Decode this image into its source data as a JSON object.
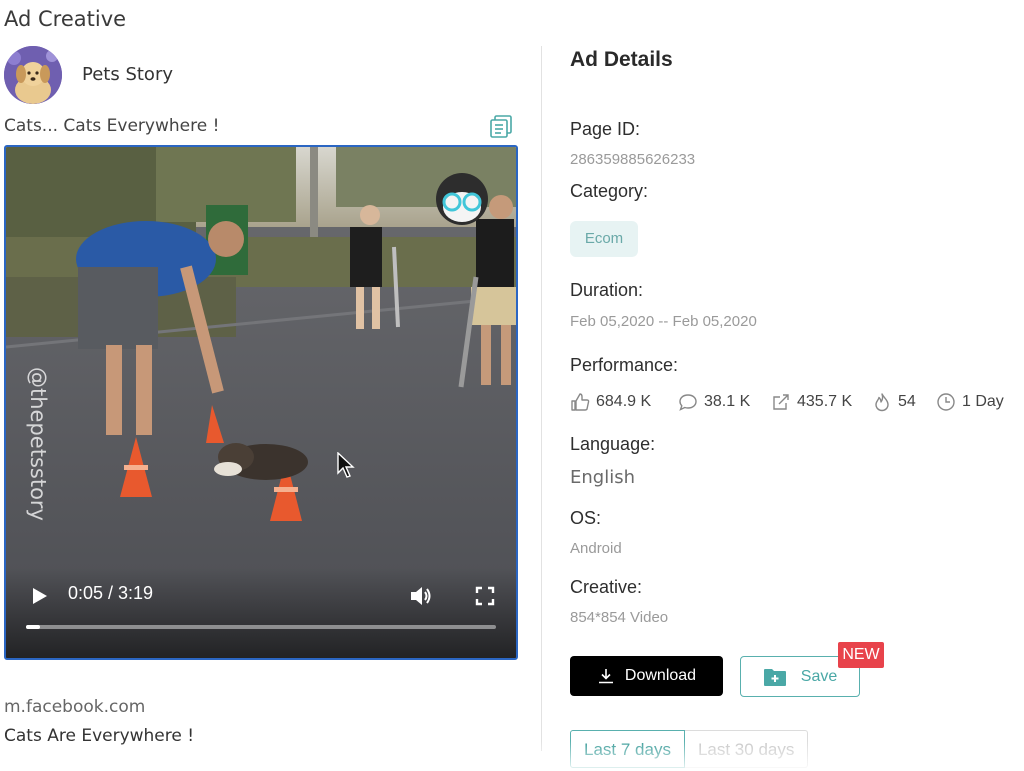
{
  "creative": {
    "section_title": "Ad Creative",
    "page_name": "Pets Story",
    "ad_text": "Cats... Cats Everywhere !",
    "watermark": "@thepetsstory",
    "video": {
      "time": "0:05 / 3:19",
      "progress": 0.03
    },
    "link_domain": "m.facebook.com",
    "link_title": "Cats Are Everywhere !"
  },
  "details": {
    "title": "Ad Details",
    "page_id_label": "Page ID:",
    "page_id": "286359885626233",
    "category_label": "Category:",
    "category": "Ecom",
    "duration_label": "Duration:",
    "duration": "Feb 05,2020 -- Feb 05,2020",
    "performance_label": "Performance:",
    "stats": {
      "likes": "684.9 K",
      "comments": "38.1 K",
      "shares": "435.7 K",
      "popularity": "54",
      "days": "1 Day"
    },
    "language_label": "Language:",
    "language": "English",
    "os_label": "OS:",
    "os": "Android",
    "creative_label": "Creative:",
    "creative": "854*854 Video"
  },
  "actions": {
    "download": "Download",
    "save": "Save",
    "new_badge": "NEW"
  },
  "range_tabs": [
    "Last 7 days",
    "Last 30 days"
  ],
  "colors": {
    "accent": "#4aa8a6",
    "video_border": "#2b66c3",
    "badge": "#e8434b"
  }
}
